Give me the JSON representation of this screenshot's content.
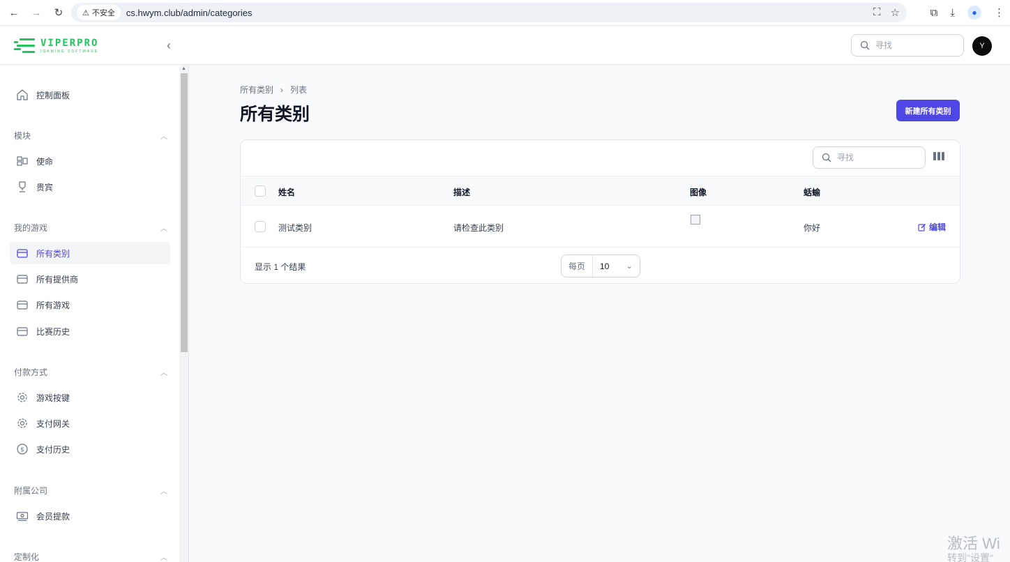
{
  "browser": {
    "insecure_label": "不安全",
    "url": "cs.hwym.club/admin/categories"
  },
  "header": {
    "logo_title": "VIPERPRO",
    "logo_sub": "IGAMING SOFTWARE",
    "search_placeholder": "寻找",
    "avatar_initial": "Y"
  },
  "sidebar": {
    "dashboard": "控制面板",
    "sections": [
      {
        "label": "模块",
        "items": [
          "使命",
          "贵宾"
        ]
      },
      {
        "label": "我的游戏",
        "items": [
          "所有类别",
          "所有提供商",
          "所有游戏",
          "比赛历史"
        ]
      },
      {
        "label": "付款方式",
        "items": [
          "游戏按键",
          "支付网关",
          "支付历史"
        ]
      },
      {
        "label": "附属公司",
        "items": [
          "会员提款"
        ]
      },
      {
        "label": "定制化",
        "items": []
      }
    ],
    "active_item": "所有类别"
  },
  "main": {
    "breadcrumb": [
      "所有类别",
      "列表"
    ],
    "title": "所有类别",
    "new_button": "新建所有类别",
    "table": {
      "search_placeholder": "寻找",
      "columns": [
        "姓名",
        "描述",
        "图像",
        "蛞蝓"
      ],
      "rows": [
        {
          "name": "测试类别",
          "description": "请检查此类别",
          "slug": "你好",
          "action": "编辑"
        }
      ],
      "result_count": "显示 1 个结果",
      "per_page_label": "每页",
      "per_page_value": "10"
    }
  },
  "watermark": {
    "line1": "激活 Wi",
    "line2": "转到\"设置\""
  },
  "colors": {
    "primary": "#4f46e5",
    "brand_green": "#22c55e"
  }
}
